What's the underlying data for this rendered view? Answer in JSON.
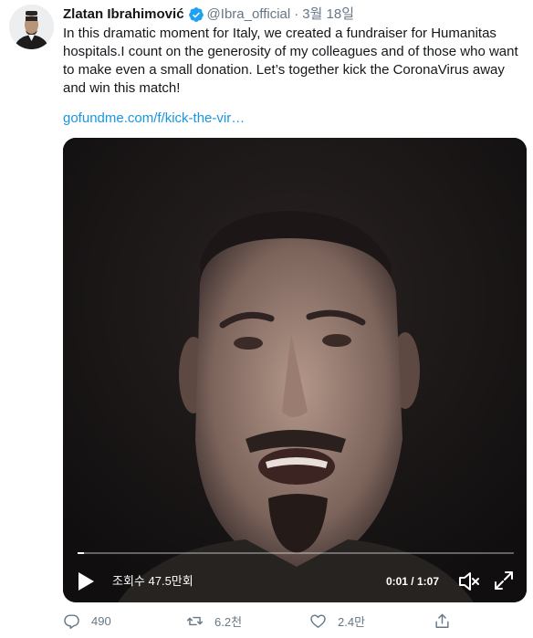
{
  "user": {
    "display_name": "Zlatan Ibrahimović",
    "handle": "@Ibra_official",
    "separator": "·",
    "date": "3월 18일",
    "verified": true
  },
  "tweet": {
    "text": "In this dramatic moment for Italy, we created a fundraiser for Humanitas hospitals.I count on the generosity of my colleagues and of those who want to make even a small donation. Let’s together kick the CoronaVirus away and win this match!",
    "link": "gofundme.com/f/kick-the-vir…"
  },
  "video": {
    "view_count": "조회수 47.5만회",
    "time": "0:01 / 1:07",
    "progress_fraction": 0.015
  },
  "actions": {
    "reply_count": "490",
    "retweet_count": "6.2천",
    "like_count": "2.4만"
  },
  "colors": {
    "accent": "#1b95e0",
    "muted": "#657786",
    "verified": "#1da1f2"
  }
}
